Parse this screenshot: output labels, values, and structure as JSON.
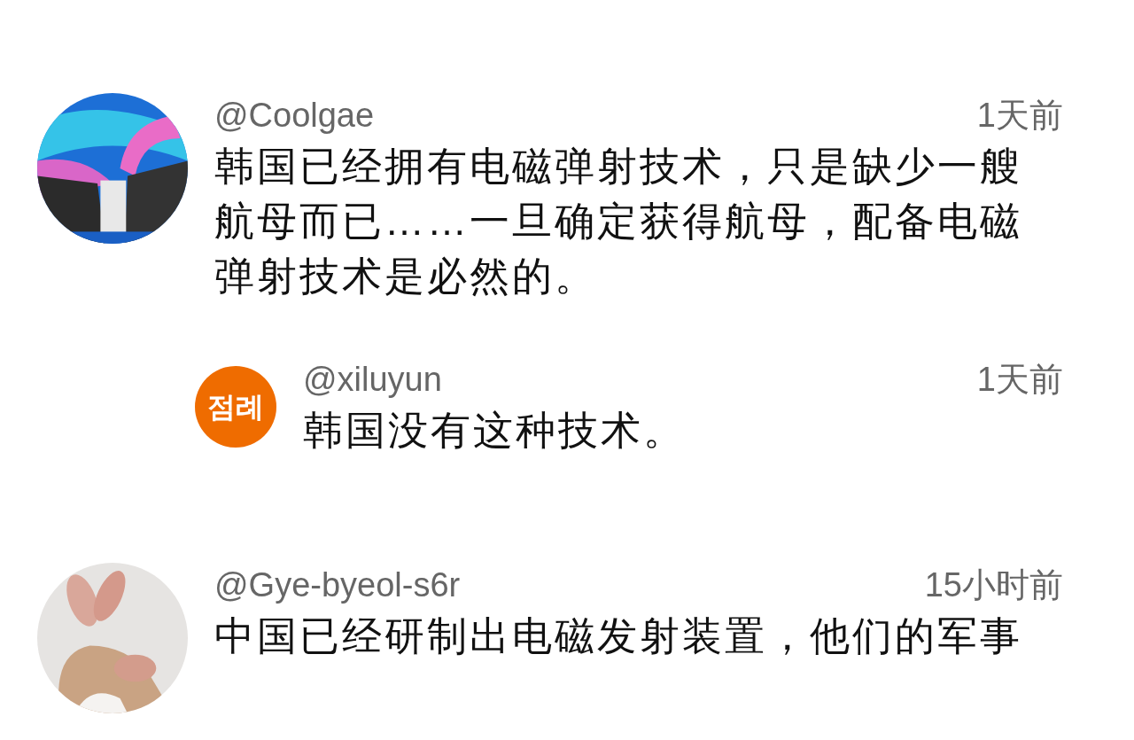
{
  "comments": [
    {
      "username": "@Coolgae",
      "time": "1天前",
      "text": "韩国已经拥有电磁弹射技术，只是缺少一艘航母而已……一旦确定获得航母，配备电磁弹射技术是必然的。",
      "avatar": {
        "kind": "picture"
      },
      "replies": [
        {
          "username": "@xiluyun",
          "time": "1天前",
          "text": "韩国没有这种技术。",
          "avatar": {
            "kind": "initials",
            "text": "점례",
            "color": "#ef6c00"
          }
        }
      ]
    },
    {
      "username": "@Gye-byeol-s6r",
      "time": "15小时前",
      "text": "中国已经研制出电磁发射装置，他们的军事",
      "avatar": {
        "kind": "picture"
      }
    }
  ]
}
